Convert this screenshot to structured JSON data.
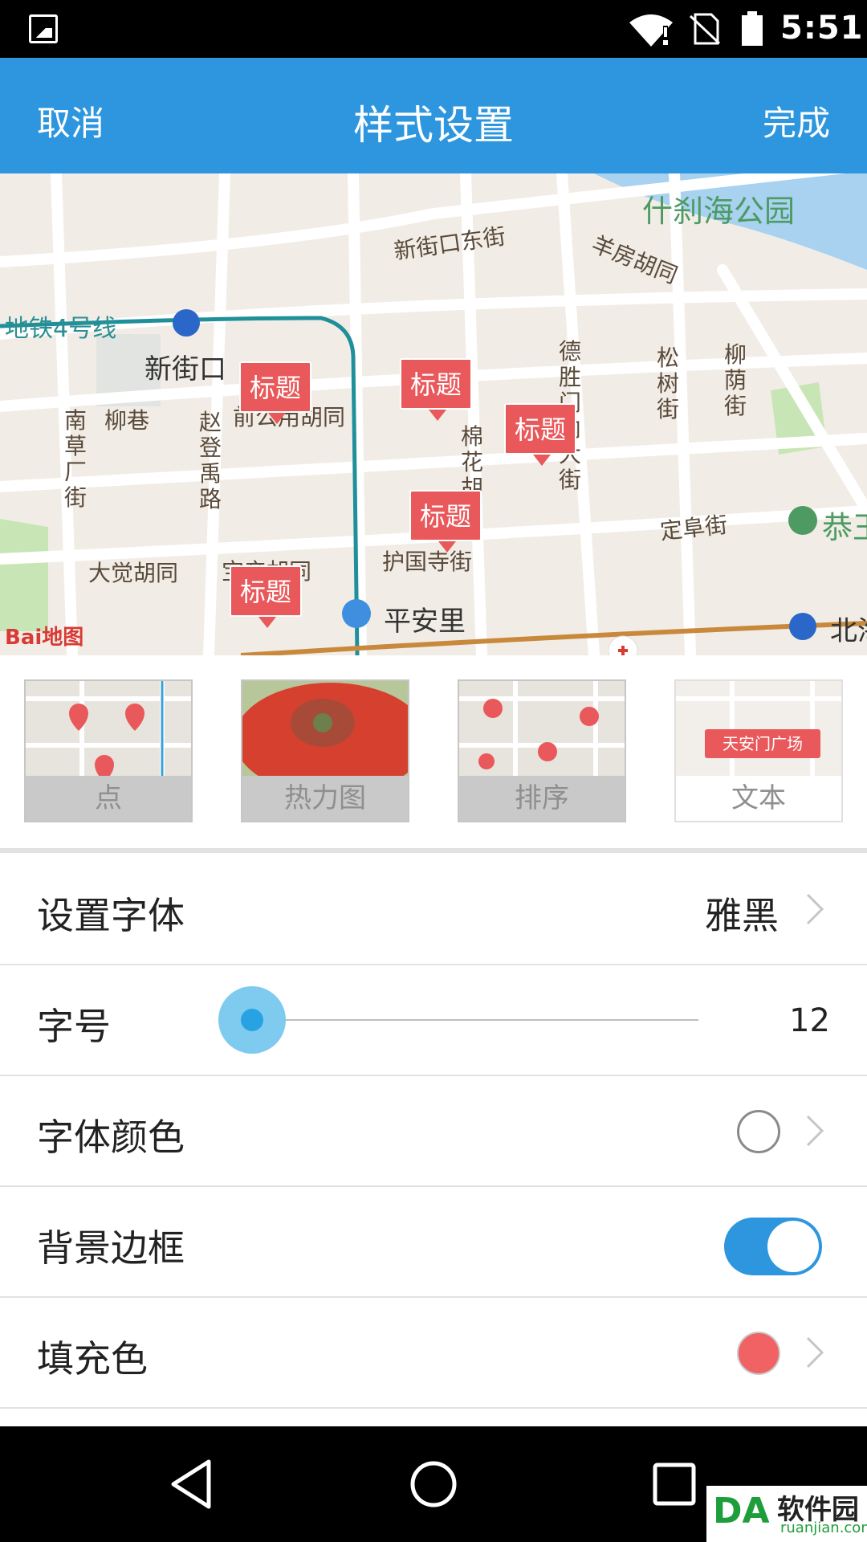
{
  "status_bar": {
    "time": "5:51",
    "icons": [
      "image-icon",
      "wifi-icon",
      "no-sim-icon",
      "battery-icon"
    ]
  },
  "header": {
    "cancel_label": "取消",
    "title": "样式设置",
    "done_label": "完成"
  },
  "map": {
    "streets": [
      "什刹海公园",
      "新街口东街",
      "羊房胡同",
      "地铁4号线",
      "新街口",
      "柳巷",
      "前公用胡同",
      "大觉胡同",
      "宝产胡同",
      "护国寺街",
      "平安里",
      "定阜街",
      "恭王",
      "北海"
    ],
    "vertical_streets": [
      "南草厂街",
      "赵登禹路",
      "棉花胡同",
      "德胜门内大街",
      "松树街",
      "柳荫街"
    ],
    "markers": [
      "标题",
      "标题",
      "标题",
      "标题",
      "标题"
    ],
    "brand": "Bai地图",
    "colors": {
      "marker": "#e9585a",
      "road": "#ffffff",
      "metro_line": "#1f8f9a",
      "water": "#a8d2f0"
    }
  },
  "styles": [
    {
      "label": "点"
    },
    {
      "label": "热力图"
    },
    {
      "label": "排序"
    },
    {
      "label": "文本",
      "sample": "天安门广场"
    }
  ],
  "settings": {
    "font": {
      "label": "设置字体",
      "value": "雅黑"
    },
    "size": {
      "label": "字号",
      "value": "12",
      "level": 0
    },
    "font_color": {
      "label": "字体颜色",
      "color": "#ffffff"
    },
    "bg_border": {
      "label": "背景边框",
      "on": true
    },
    "fill_color": {
      "label": "填充色",
      "color": "#f06263"
    }
  },
  "accent_color": "#2d96de",
  "watermark": {
    "logo": "DA",
    "name": "软件园",
    "domain": "ruanjian.com"
  }
}
